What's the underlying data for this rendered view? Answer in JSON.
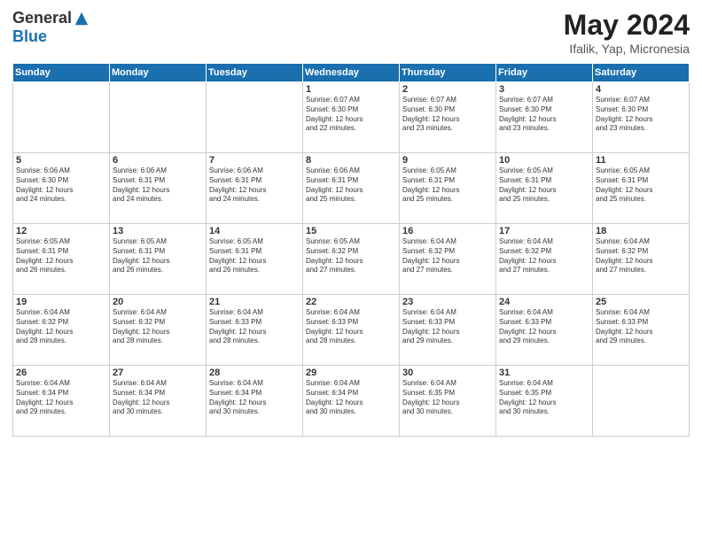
{
  "header": {
    "logo_general": "General",
    "logo_blue": "Blue",
    "month_year": "May 2024",
    "location": "Ifalik, Yap, Micronesia"
  },
  "days_of_week": [
    "Sunday",
    "Monday",
    "Tuesday",
    "Wednesday",
    "Thursday",
    "Friday",
    "Saturday"
  ],
  "weeks": [
    [
      {
        "day": "",
        "info": ""
      },
      {
        "day": "",
        "info": ""
      },
      {
        "day": "",
        "info": ""
      },
      {
        "day": "1",
        "info": "Sunrise: 6:07 AM\nSunset: 6:30 PM\nDaylight: 12 hours\nand 22 minutes."
      },
      {
        "day": "2",
        "info": "Sunrise: 6:07 AM\nSunset: 6:30 PM\nDaylight: 12 hours\nand 23 minutes."
      },
      {
        "day": "3",
        "info": "Sunrise: 6:07 AM\nSunset: 6:30 PM\nDaylight: 12 hours\nand 23 minutes."
      },
      {
        "day": "4",
        "info": "Sunrise: 6:07 AM\nSunset: 6:30 PM\nDaylight: 12 hours\nand 23 minutes."
      }
    ],
    [
      {
        "day": "5",
        "info": "Sunrise: 6:06 AM\nSunset: 6:30 PM\nDaylight: 12 hours\nand 24 minutes."
      },
      {
        "day": "6",
        "info": "Sunrise: 6:06 AM\nSunset: 6:31 PM\nDaylight: 12 hours\nand 24 minutes."
      },
      {
        "day": "7",
        "info": "Sunrise: 6:06 AM\nSunset: 6:31 PM\nDaylight: 12 hours\nand 24 minutes."
      },
      {
        "day": "8",
        "info": "Sunrise: 6:06 AM\nSunset: 6:31 PM\nDaylight: 12 hours\nand 25 minutes."
      },
      {
        "day": "9",
        "info": "Sunrise: 6:05 AM\nSunset: 6:31 PM\nDaylight: 12 hours\nand 25 minutes."
      },
      {
        "day": "10",
        "info": "Sunrise: 6:05 AM\nSunset: 6:31 PM\nDaylight: 12 hours\nand 25 minutes."
      },
      {
        "day": "11",
        "info": "Sunrise: 6:05 AM\nSunset: 6:31 PM\nDaylight: 12 hours\nand 25 minutes."
      }
    ],
    [
      {
        "day": "12",
        "info": "Sunrise: 6:05 AM\nSunset: 6:31 PM\nDaylight: 12 hours\nand 26 minutes."
      },
      {
        "day": "13",
        "info": "Sunrise: 6:05 AM\nSunset: 6:31 PM\nDaylight: 12 hours\nand 26 minutes."
      },
      {
        "day": "14",
        "info": "Sunrise: 6:05 AM\nSunset: 6:31 PM\nDaylight: 12 hours\nand 26 minutes."
      },
      {
        "day": "15",
        "info": "Sunrise: 6:05 AM\nSunset: 6:32 PM\nDaylight: 12 hours\nand 27 minutes."
      },
      {
        "day": "16",
        "info": "Sunrise: 6:04 AM\nSunset: 6:32 PM\nDaylight: 12 hours\nand 27 minutes."
      },
      {
        "day": "17",
        "info": "Sunrise: 6:04 AM\nSunset: 6:32 PM\nDaylight: 12 hours\nand 27 minutes."
      },
      {
        "day": "18",
        "info": "Sunrise: 6:04 AM\nSunset: 6:32 PM\nDaylight: 12 hours\nand 27 minutes."
      }
    ],
    [
      {
        "day": "19",
        "info": "Sunrise: 6:04 AM\nSunset: 6:32 PM\nDaylight: 12 hours\nand 28 minutes."
      },
      {
        "day": "20",
        "info": "Sunrise: 6:04 AM\nSunset: 6:32 PM\nDaylight: 12 hours\nand 28 minutes."
      },
      {
        "day": "21",
        "info": "Sunrise: 6:04 AM\nSunset: 6:33 PM\nDaylight: 12 hours\nand 28 minutes."
      },
      {
        "day": "22",
        "info": "Sunrise: 6:04 AM\nSunset: 6:33 PM\nDaylight: 12 hours\nand 28 minutes."
      },
      {
        "day": "23",
        "info": "Sunrise: 6:04 AM\nSunset: 6:33 PM\nDaylight: 12 hours\nand 29 minutes."
      },
      {
        "day": "24",
        "info": "Sunrise: 6:04 AM\nSunset: 6:33 PM\nDaylight: 12 hours\nand 29 minutes."
      },
      {
        "day": "25",
        "info": "Sunrise: 6:04 AM\nSunset: 6:33 PM\nDaylight: 12 hours\nand 29 minutes."
      }
    ],
    [
      {
        "day": "26",
        "info": "Sunrise: 6:04 AM\nSunset: 6:34 PM\nDaylight: 12 hours\nand 29 minutes."
      },
      {
        "day": "27",
        "info": "Sunrise: 6:04 AM\nSunset: 6:34 PM\nDaylight: 12 hours\nand 30 minutes."
      },
      {
        "day": "28",
        "info": "Sunrise: 6:04 AM\nSunset: 6:34 PM\nDaylight: 12 hours\nand 30 minutes."
      },
      {
        "day": "29",
        "info": "Sunrise: 6:04 AM\nSunset: 6:34 PM\nDaylight: 12 hours\nand 30 minutes."
      },
      {
        "day": "30",
        "info": "Sunrise: 6:04 AM\nSunset: 6:35 PM\nDaylight: 12 hours\nand 30 minutes."
      },
      {
        "day": "31",
        "info": "Sunrise: 6:04 AM\nSunset: 6:35 PM\nDaylight: 12 hours\nand 30 minutes."
      },
      {
        "day": "",
        "info": ""
      }
    ]
  ]
}
